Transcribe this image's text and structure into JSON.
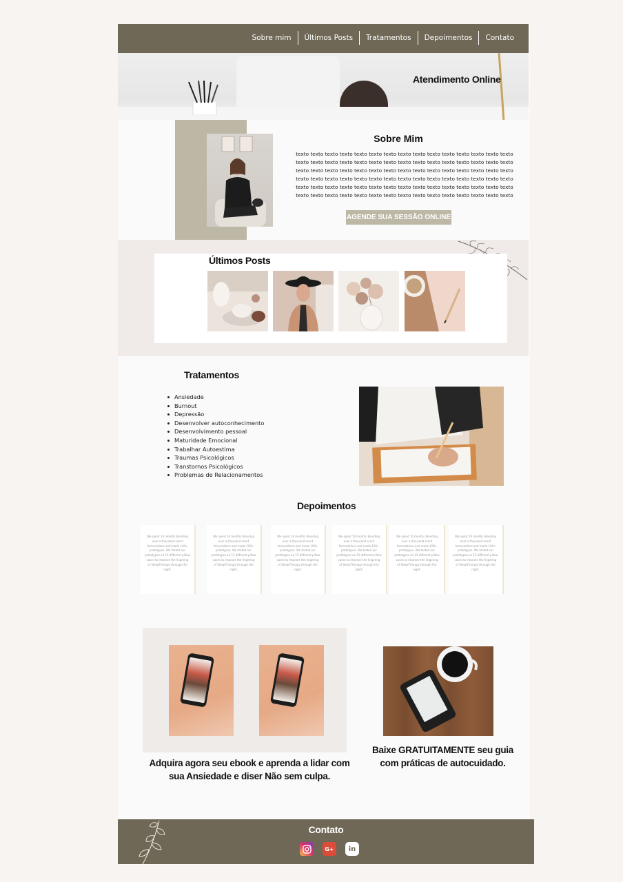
{
  "nav": {
    "items": [
      "Sobre mim",
      "Últimos Posts",
      "Tratamentos",
      "Depoimentos",
      "Contato"
    ]
  },
  "hero": {
    "title": "Atendimento Online"
  },
  "about": {
    "title": "Sobre Mim",
    "text": "texto texto texto texto texto texto texto texto texto texto texto texto texto texto texto texto texto texto texto texto texto texto texto texto texto texto texto texto texto texto texto texto texto texto texto texto texto texto texto texto texto texto texto texto texto texto texto texto texto texto texto texto texto texto texto texto texto texto texto texto texto texto texto texto texto texto texto texto texto texto texto texto texto texto texto texto texto texto texto texto texto texto texto texto texto texto texto texto texto texto",
    "button_label": "AGENDE SUA SESSÃO ONLINE"
  },
  "posts": {
    "title": "Últimos Posts"
  },
  "treatments": {
    "title": "Tratamentos",
    "items": [
      "Ansiedade",
      "Burnout",
      "Depressão",
      "Desenvolver autoconhecimento",
      "Desenvolvimento pessoal",
      "Maturidade Emocional",
      "Trabalhar Autoestima",
      "Traumas Psicológicos",
      "Transtornos Psicológicos",
      "Problemas de Relacionamentos"
    ]
  },
  "testimonials": {
    "title": "Depoimentos",
    "cards": [
      "We spent 10 months blending over a thousand scent formulations and made 100+ prototypes. We tested our prototypes on 15 different pillow cases to improve the lingering of SleepTherapy through the night.",
      "We spent 10 months blending over a thousand scent formulations and made 100+ prototypes. We tested our prototypes on 15 different pillow cases to improve the lingering of SleepTherapy through the night.",
      "We spent 10 months blending over a thousand scent formulations and made 100+ prototypes. We tested our prototypes on 15 different pillow cases to improve the lingering of SleepTherapy through the night.",
      "We spent 10 months blending over a thousand scent formulations and made 100+ prototypes. We tested our prototypes on 15 different pillow cases to improve the lingering of SleepTherapy through the night.",
      "We spent 10 months blending over a thousand scent formulations and made 100+ prototypes. We tested our prototypes on 15 different pillow cases to improve the lingering of SleepTherapy through the night.",
      "We spent 10 months blending over a thousand scent formulations and made 100+ prototypes. We tested our prototypes on 15 different pillow cases to improve the lingering of SleepTherapy through the night."
    ]
  },
  "promos": {
    "ebook_caption": "Adquira agora seu ebook e aprenda a lidar com sua Ansiedade e diser Não sem culpa.",
    "guide_caption": "Baixe GRATUITAMENTE seu guia com práticas de autocuidado."
  },
  "footer": {
    "title": "Contato",
    "socials": [
      {
        "icon": "instagram-icon",
        "color": "#c13584"
      },
      {
        "icon": "google-plus-icon",
        "color": "#dd4b39"
      },
      {
        "icon": "linkedin-icon",
        "color": "#ffffff"
      }
    ]
  },
  "colors": {
    "brand": "#6f6856",
    "accent": "#bdb7a6",
    "band": "#f0ebe8"
  }
}
